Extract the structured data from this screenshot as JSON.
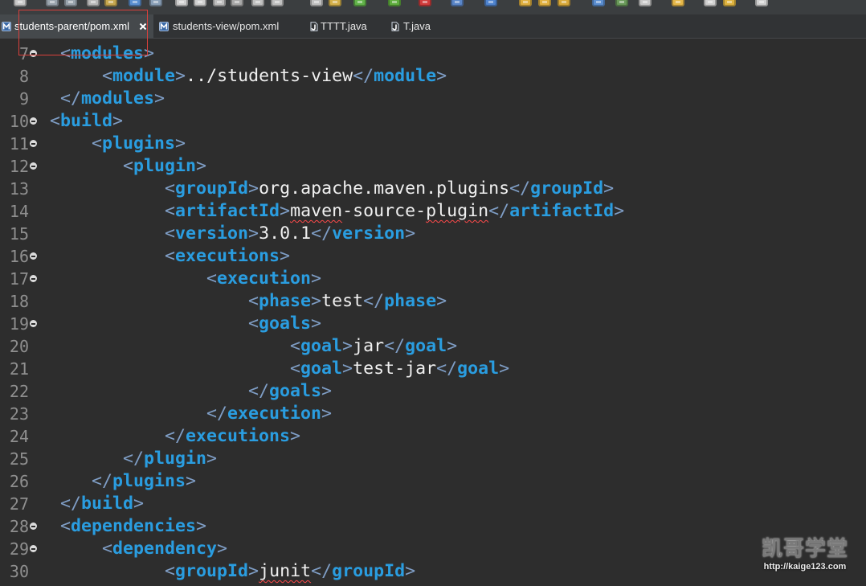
{
  "colors": {
    "editor_background": "#2d2d2d",
    "tag_name": "#2a9de0",
    "tag_bracket": "#7f9ec6",
    "text": "#f0f0f0",
    "line_number": "#8f8f8f",
    "spelling_error": "#ff4a4a",
    "annotation_box": "#d9403c"
  },
  "toolbar": {
    "icons": [
      {
        "name": "new-icon",
        "color": "#c9c9c9"
      },
      {
        "name": "save-icon",
        "color": "#9aa4ad"
      },
      {
        "name": "save-all-icon",
        "color": "#9aa4ad"
      },
      {
        "name": "print-icon",
        "color": "#b8b8b8"
      },
      {
        "name": "toolbox-icon",
        "color": "#c7a84f"
      },
      {
        "name": "console-icon",
        "color": "#5a8fd0"
      },
      {
        "name": "search-icon",
        "color": "#8aa0b8"
      },
      {
        "name": "resume-icon",
        "color": "#d0d0d0"
      },
      {
        "name": "suspend-icon",
        "color": "#d0d0d0"
      },
      {
        "name": "terminate-icon",
        "color": "#bfbfbf"
      },
      {
        "name": "disconnect-icon",
        "color": "#a8a8a8"
      },
      {
        "name": "step-into-icon",
        "color": "#c0c0c0"
      },
      {
        "name": "step-over-icon",
        "color": "#c0c0c0"
      },
      {
        "name": "step-return-icon",
        "color": "#c0c0c0"
      },
      {
        "name": "drop-to-frame-icon",
        "color": "#d4b04a"
      },
      {
        "name": "use-step-filters-icon",
        "color": "#62b34a"
      },
      {
        "name": "debug-icon",
        "color": "#5fae3e"
      },
      {
        "name": "stop-icon",
        "color": "#d23c3c"
      },
      {
        "name": "external-tools-icon",
        "color": "#5a86c8"
      },
      {
        "name": "web-browser-icon",
        "color": "#4f84cf"
      },
      {
        "name": "open-type-icon",
        "color": "#e0b040"
      },
      {
        "name": "open-task-icon",
        "color": "#e0b040"
      },
      {
        "name": "open-resource-icon",
        "color": "#d9a93a"
      },
      {
        "name": "next-annotation-icon",
        "color": "#5b8ed0"
      },
      {
        "name": "previous-annotation-icon",
        "color": "#6a9a5a"
      },
      {
        "name": "last-edit-location-icon",
        "color": "#c8c8c8"
      },
      {
        "name": "pin-editor-icon",
        "color": "#e6b84a"
      },
      {
        "name": "back-icon",
        "color": "#d0d0d0"
      },
      {
        "name": "forward-icon",
        "color": "#e0b440"
      },
      {
        "name": "redo-icon",
        "color": "#d0d0d0"
      }
    ]
  },
  "tabs": [
    {
      "label": "students-parent/pom.xml",
      "icon": "maven-pom-file-icon",
      "active": true,
      "closable": true
    },
    {
      "label": "students-view/pom.xml",
      "icon": "maven-pom-file-icon",
      "active": false
    },
    {
      "label": "TTTT.java",
      "icon": "java-file-icon",
      "active": false
    },
    {
      "label": "T.java",
      "icon": "java-file-icon",
      "active": false
    }
  ],
  "editor": {
    "lines": [
      {
        "number": 7,
        "foldable": true,
        "text": "  <modules>"
      },
      {
        "number": 8,
        "foldable": false,
        "text": "      <module>../students-view</module>"
      },
      {
        "number": 9,
        "foldable": false,
        "text": "  </modules>"
      },
      {
        "number": 10,
        "foldable": true,
        "text": " <build>"
      },
      {
        "number": 11,
        "foldable": true,
        "text": "     <plugins>"
      },
      {
        "number": 12,
        "foldable": true,
        "text": "        <plugin>"
      },
      {
        "number": 13,
        "foldable": false,
        "text": "            <groupId>org.apache.maven.plugins</groupId>"
      },
      {
        "number": 14,
        "foldable": false,
        "text": "            <artifactId>maven-source-plugin</artifactId>",
        "misspelled": [
          "maven",
          "plugin"
        ]
      },
      {
        "number": 15,
        "foldable": false,
        "text": "            <version>3.0.1</version>"
      },
      {
        "number": 16,
        "foldable": true,
        "text": "            <executions>"
      },
      {
        "number": 17,
        "foldable": true,
        "text": "                <execution>"
      },
      {
        "number": 18,
        "foldable": false,
        "text": "                    <phase>test</phase>"
      },
      {
        "number": 19,
        "foldable": true,
        "text": "                    <goals>"
      },
      {
        "number": 20,
        "foldable": false,
        "text": "                        <goal>jar</goal>"
      },
      {
        "number": 21,
        "foldable": false,
        "text": "                        <goal>test-jar</goal>"
      },
      {
        "number": 22,
        "foldable": false,
        "text": "                    </goals>"
      },
      {
        "number": 23,
        "foldable": false,
        "text": "                </execution>"
      },
      {
        "number": 24,
        "foldable": false,
        "text": "            </executions>"
      },
      {
        "number": 25,
        "foldable": false,
        "text": "        </plugin>"
      },
      {
        "number": 26,
        "foldable": false,
        "text": "     </plugins>"
      },
      {
        "number": 27,
        "foldable": false,
        "text": "  </build>"
      },
      {
        "number": 28,
        "foldable": true,
        "text": "  <dependencies>"
      },
      {
        "number": 29,
        "foldable": true,
        "text": "      <dependency>"
      },
      {
        "number": 30,
        "foldable": false,
        "text": "            <groupId>junit</groupId>",
        "misspelled": [
          "junit"
        ]
      }
    ]
  },
  "watermark": {
    "text": "凯哥学堂",
    "url": "http://kaige123.com"
  }
}
